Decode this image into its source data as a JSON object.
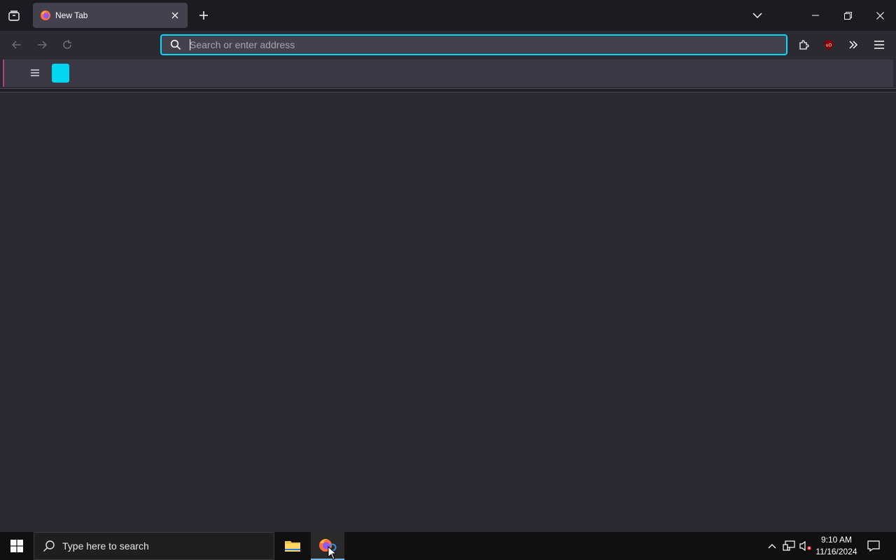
{
  "browser": {
    "tab": {
      "title": "New Tab"
    },
    "urlbar": {
      "placeholder": "Search or enter address",
      "value": ""
    },
    "accent_color": "#00ddff"
  },
  "sidebar_strip": {
    "accent_color": "#b04080",
    "tile_color": "#00d6ef"
  },
  "taskbar": {
    "search_placeholder": "Type here to search",
    "time": "9:10 AM",
    "date": "11/16/2024"
  },
  "icons": [
    "tab-list-icon",
    "firefox-icon",
    "close-icon",
    "new-tab-icon",
    "list-all-tabs-icon",
    "minimize-icon",
    "restore-icon",
    "window-close-icon",
    "back-icon",
    "forward-icon",
    "reload-icon",
    "search-icon",
    "extensions-icon",
    "ublock-icon",
    "overflow-icon",
    "app-menu-icon",
    "hamburger-icon",
    "windows-start-icon",
    "file-explorer-icon",
    "chevron-up-icon",
    "network-icon",
    "volume-icon",
    "notification-icon"
  ]
}
